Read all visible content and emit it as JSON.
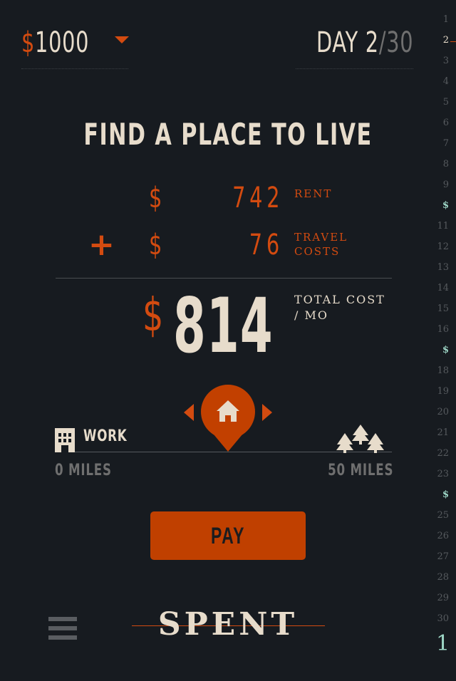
{
  "header": {
    "currency_symbol": "$",
    "balance": "1000",
    "day_label": "DAY",
    "current_day": "2",
    "separator": "/",
    "total_days": "30"
  },
  "rail": {
    "items": [
      "1",
      "2",
      "3",
      "4",
      "5",
      "6",
      "7",
      "8",
      "9",
      "$",
      "11",
      "12",
      "13",
      "14",
      "15",
      "16",
      "$",
      "18",
      "19",
      "20",
      "21",
      "22",
      "23",
      "$",
      "25",
      "26",
      "27",
      "28",
      "29",
      "30"
    ],
    "current_index": 1,
    "bottom_value": "1"
  },
  "main": {
    "title": "FIND A PLACE TO LIVE",
    "rent": {
      "currency_symbol": "$",
      "amount": "742",
      "label": "RENT"
    },
    "travel": {
      "operator": "+",
      "currency_symbol": "$",
      "amount": "76",
      "label_line1": "TRAVEL",
      "label_line2": "COSTS"
    },
    "total": {
      "currency_symbol": "$",
      "amount": "814",
      "label_line1": "TOTAL COST",
      "label_line2": "/ MO"
    }
  },
  "distance": {
    "work_label": "WORK",
    "min_label": "0 MILES",
    "max_label": "50 MILES",
    "selected_position": 0.5
  },
  "actions": {
    "pay_label": "PAY"
  },
  "footer": {
    "logo_text": "SPENT"
  },
  "colors": {
    "background": "#171b20",
    "accent": "#d34b10",
    "button": "#c04000",
    "text": "#e7dccb",
    "muted": "#6f6f6f",
    "rail_payday": "#9ed6c6"
  }
}
